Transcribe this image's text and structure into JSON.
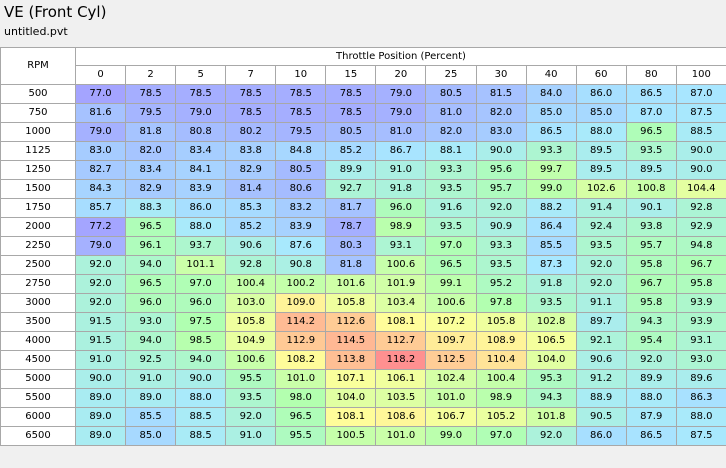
{
  "title": "VE (Front Cyl)",
  "subtitle": "untitled.pvt",
  "corner_label": "RPM",
  "col_axis_title": "Throttle Position (Percent)",
  "columns": [
    "0",
    "2",
    "5",
    "7",
    "10",
    "15",
    "20",
    "25",
    "30",
    "40",
    "60",
    "80",
    "100"
  ],
  "rows": [
    {
      "rpm": "500",
      "values": [
        "77.0",
        "78.5",
        "78.5",
        "78.5",
        "78.5",
        "78.5",
        "79.0",
        "80.5",
        "81.5",
        "84.0",
        "86.0",
        "86.5",
        "87.0"
      ]
    },
    {
      "rpm": "750",
      "values": [
        "81.6",
        "79.5",
        "79.0",
        "78.5",
        "78.5",
        "78.5",
        "79.0",
        "81.0",
        "82.0",
        "85.0",
        "85.0",
        "87.0",
        "87.5"
      ]
    },
    {
      "rpm": "1000",
      "values": [
        "79.0",
        "81.8",
        "80.8",
        "80.2",
        "79.5",
        "80.5",
        "81.0",
        "82.0",
        "83.0",
        "86.5",
        "88.0",
        "96.5",
        "88.5"
      ]
    },
    {
      "rpm": "1125",
      "values": [
        "83.0",
        "82.0",
        "83.4",
        "83.8",
        "84.8",
        "85.2",
        "86.7",
        "88.1",
        "90.0",
        "93.3",
        "89.5",
        "93.5",
        "90.0"
      ]
    },
    {
      "rpm": "1250",
      "values": [
        "82.7",
        "83.4",
        "84.1",
        "82.9",
        "80.5",
        "89.9",
        "91.0",
        "93.3",
        "95.6",
        "99.7",
        "89.5",
        "89.5",
        "90.0"
      ]
    },
    {
      "rpm": "1500",
      "values": [
        "84.3",
        "82.9",
        "83.9",
        "81.4",
        "80.6",
        "92.7",
        "91.8",
        "93.5",
        "95.7",
        "99.0",
        "102.6",
        "100.8",
        "104.4"
      ]
    },
    {
      "rpm": "1750",
      "values": [
        "85.7",
        "88.3",
        "86.0",
        "85.3",
        "83.2",
        "81.7",
        "96.0",
        "91.6",
        "92.0",
        "88.2",
        "91.4",
        "90.1",
        "92.8"
      ]
    },
    {
      "rpm": "2000",
      "values": [
        "77.2",
        "96.5",
        "88.0",
        "85.2",
        "83.9",
        "78.7",
        "98.9",
        "93.5",
        "90.9",
        "86.4",
        "92.4",
        "93.8",
        "92.9"
      ]
    },
    {
      "rpm": "2250",
      "values": [
        "79.0",
        "96.1",
        "93.7",
        "90.6",
        "87.6",
        "80.3",
        "93.1",
        "97.0",
        "93.3",
        "85.5",
        "93.5",
        "95.7",
        "94.8"
      ]
    },
    {
      "rpm": "2500",
      "values": [
        "92.0",
        "94.0",
        "101.1",
        "92.8",
        "90.8",
        "81.8",
        "100.6",
        "96.5",
        "93.5",
        "87.3",
        "92.0",
        "95.8",
        "96.7"
      ]
    },
    {
      "rpm": "2750",
      "values": [
        "92.0",
        "96.5",
        "97.0",
        "100.4",
        "100.2",
        "101.6",
        "101.9",
        "99.1",
        "95.2",
        "91.8",
        "92.0",
        "96.7",
        "95.8"
      ]
    },
    {
      "rpm": "3000",
      "values": [
        "92.0",
        "96.0",
        "96.0",
        "103.0",
        "109.0",
        "105.8",
        "103.4",
        "100.6",
        "97.8",
        "93.5",
        "91.1",
        "95.8",
        "93.9"
      ]
    },
    {
      "rpm": "3500",
      "values": [
        "91.5",
        "93.0",
        "97.5",
        "105.8",
        "114.2",
        "112.6",
        "108.1",
        "107.2",
        "105.8",
        "102.8",
        "89.7",
        "94.3",
        "93.9"
      ]
    },
    {
      "rpm": "4000",
      "values": [
        "91.5",
        "94.0",
        "98.5",
        "104.9",
        "112.9",
        "114.5",
        "112.7",
        "109.7",
        "108.9",
        "106.5",
        "92.1",
        "95.4",
        "93.1"
      ]
    },
    {
      "rpm": "4500",
      "values": [
        "91.0",
        "92.5",
        "94.0",
        "100.6",
        "108.2",
        "113.8",
        "118.2",
        "112.5",
        "110.4",
        "104.0",
        "90.6",
        "92.0",
        "93.0"
      ]
    },
    {
      "rpm": "5000",
      "values": [
        "90.0",
        "91.0",
        "90.0",
        "95.5",
        "101.0",
        "107.1",
        "106.1",
        "102.4",
        "100.4",
        "95.3",
        "91.2",
        "89.9",
        "89.6"
      ]
    },
    {
      "rpm": "5500",
      "values": [
        "89.0",
        "89.0",
        "88.0",
        "93.5",
        "98.0",
        "104.0",
        "103.5",
        "101.0",
        "98.9",
        "94.3",
        "88.9",
        "88.0",
        "86.3"
      ]
    },
    {
      "rpm": "6000",
      "values": [
        "89.0",
        "85.5",
        "88.5",
        "92.0",
        "96.5",
        "108.1",
        "108.6",
        "106.7",
        "105.2",
        "101.8",
        "90.5",
        "87.9",
        "88.0"
      ]
    },
    {
      "rpm": "6500",
      "values": [
        "89.0",
        "85.0",
        "88.5",
        "91.0",
        "95.5",
        "100.5",
        "101.0",
        "99.0",
        "97.0",
        "92.0",
        "86.0",
        "86.5",
        "87.5"
      ]
    }
  ],
  "color_scale": {
    "min": 77.0,
    "max": 118.2,
    "stops": [
      "#a4a4ff",
      "#a8e8ff",
      "#b0ffb0",
      "#ffff9a",
      "#ff9090"
    ]
  }
}
